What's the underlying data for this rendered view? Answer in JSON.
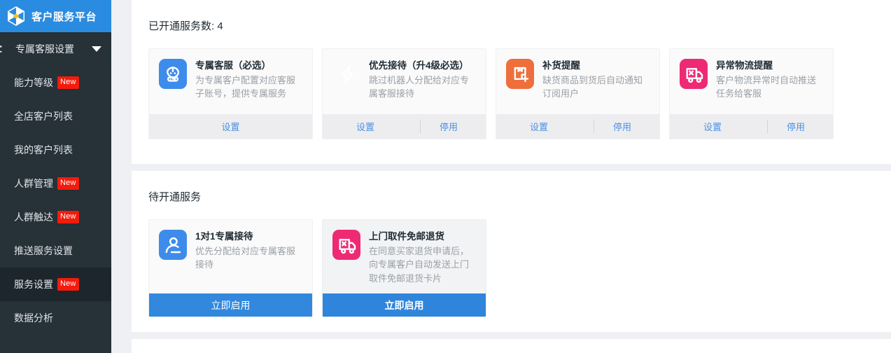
{
  "brand": {
    "title": "客户服务平台",
    "logo_icon": "origami-diamond-logo-icon",
    "bg_color": "#2a8ce0"
  },
  "sidebar": {
    "bg_color": "#263138",
    "active_bg_color": "#1d262c",
    "badge_color": "#f31b0c",
    "group": {
      "icon": "vip-service-icon",
      "label": "专属客服设置",
      "caret_icon": "chevron-down-icon"
    },
    "items": [
      {
        "label": "能力等级",
        "badge": "New",
        "active": false
      },
      {
        "label": "全店客户列表",
        "badge": "",
        "active": false
      },
      {
        "label": "我的客户列表",
        "badge": "",
        "active": false
      },
      {
        "label": "人群管理",
        "badge": "New",
        "active": false
      },
      {
        "label": "人群触达",
        "badge": "New",
        "active": false
      },
      {
        "label": "推送服务设置",
        "badge": "",
        "active": false
      },
      {
        "label": "服务设置",
        "badge": "New",
        "active": true
      },
      {
        "label": "数据分析",
        "badge": "",
        "active": false
      }
    ]
  },
  "main": {
    "opened": {
      "title": "已开通服务数: 4",
      "count": 4,
      "cards": [
        {
          "icon": "robot-chat-icon",
          "icon_color": "#3d8ceb",
          "name": "专属客服（必选）",
          "desc": "为专属客户配置对应客服子账号，提供专属服务",
          "actions": {
            "primary": "设置",
            "secondary": ""
          }
        },
        {
          "icon": "lightning-bolt-icon",
          "icon_color": "#f5a council",
          "name": "优先接待（升4级必选）",
          "desc": "跳过机器人分配给对应专属客服接待",
          "actions": {
            "primary": "设置",
            "secondary": "停用"
          }
        },
        {
          "icon": "box-plus-icon",
          "icon_color": "#ee6f3c",
          "name": "补货提醒",
          "desc": "缺货商品到货后自动通知订阅用户",
          "actions": {
            "primary": "设置",
            "secondary": "停用"
          }
        },
        {
          "icon": "truck-alert-icon",
          "icon_color": "#ee2a74",
          "name": "异常物流提醒",
          "desc": "客户物流异常时自动推送任务给客服",
          "actions": {
            "primary": "设置",
            "secondary": "停用"
          }
        }
      ]
    },
    "pending": {
      "title": "待开通服务",
      "cards": [
        {
          "icon": "person-icon",
          "icon_color": "#3d8ceb",
          "name": "1对1专属接待",
          "desc": "优先分配给对应专属客服接待",
          "button": "立即启用",
          "highlighted": false
        },
        {
          "icon": "truck-alert-icon",
          "icon_color": "#ee2a74",
          "name": "上门取件免邮退货",
          "desc": "在同意买家退货申请后，向专属客户自动发送上门取件免邮退货卡片",
          "button": "立即启用",
          "highlighted": true
        }
      ]
    }
  },
  "colors": {
    "accent_blue": "#3288dd",
    "link_blue": "#4a91e2",
    "page_bg": "#eef0f4",
    "panel_bg": "#ffffff"
  }
}
